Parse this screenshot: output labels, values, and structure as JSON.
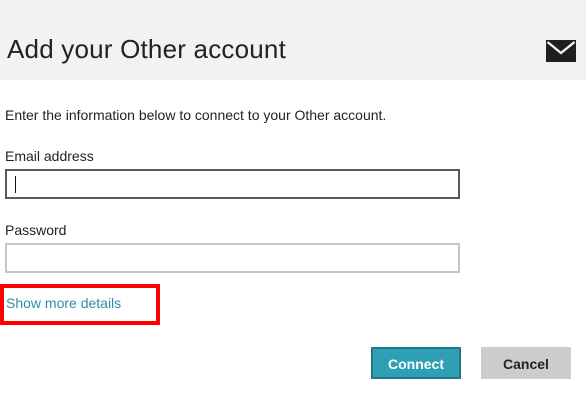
{
  "dialog": {
    "title": "Add your Other account",
    "header_icon": "mail-icon",
    "intro_text": "Enter the information below to connect to your Other account."
  },
  "form": {
    "email": {
      "label": "Email address",
      "value": "",
      "placeholder": ""
    },
    "password": {
      "label": "Password",
      "value": "",
      "placeholder": ""
    },
    "show_more_label": "Show more details"
  },
  "actions": {
    "connect_label": "Connect",
    "cancel_label": "Cancel"
  },
  "colors": {
    "header_background": "#f2f2f2",
    "accent": "#2e9fb4",
    "link": "#2d8fa6",
    "highlight_box": "#ff0000",
    "cancel_button": "#cccccc"
  }
}
